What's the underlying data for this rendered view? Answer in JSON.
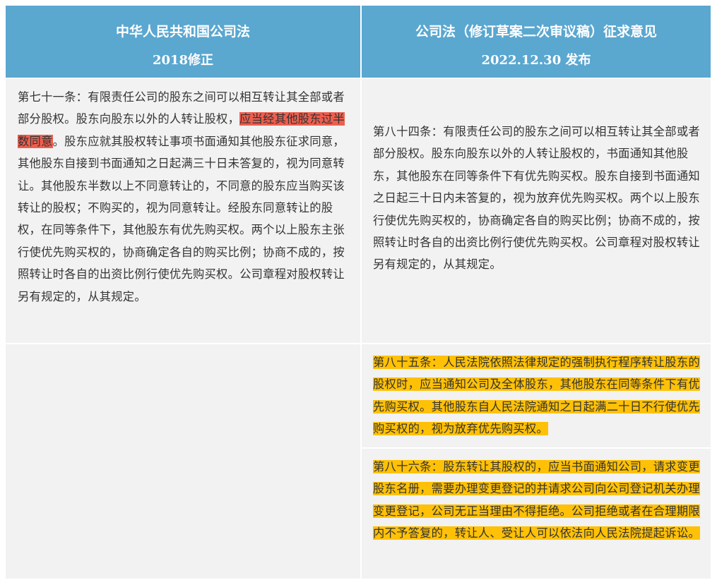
{
  "headers": {
    "left": {
      "title": "中华人民共和国公司法",
      "subtitle": "2018修正"
    },
    "right": {
      "title": "公司法（修订草案二次审议稿）征求意见",
      "subtitle": "2022.12.30 发布"
    }
  },
  "left_article": {
    "part1": "第七十一条：有限责任公司的股东之间可以相互转让其全部或者部分股权。股东向股东以外的人转让股权，",
    "highlight": "应当经其他股东过半数同意",
    "part2": "。股东应就其股权转让事项书面通知其他股东征求同意，其他股东自接到书面通知之日起满三十日未答复的，视为同意转让。其他股东半数以上不同意转让的，不同意的股东应当购买该转让的股权；不购买的，视为同意转让。经股东同意转让的股权，在同等条件下，其他股东有优先购买权。两个以上股东主张行使优先购买权的，协商确定各自的购买比例；协商不成的，按照转让时各自的出资比例行使优先购买权。公司章程对股权转让另有规定的，从其规定。"
  },
  "right_articles": {
    "art84": "第八十四条：有限责任公司的股东之间可以相互转让其全部或者部分股权。股东向股东以外的人转让股权的，书面通知其他股东，其他股东在同等条件下有优先购买权。股东自接到书面通知之日起三十日内未答复的，视为放弃优先购买权。两个以上股东行使优先购买权的，协商确定各自的购买比例；协商不成的，按照转让时各自的出资比例行使优先购买权。公司章程对股权转让另有规定的，从其规定。",
    "art85": "第八十五条：人民法院依照法律规定的强制执行程序转让股东的股权时，应当通知公司及全体股东，其他股东在同等条件下有优先购买权。其他股东自人民法院通知之日起满二十日不行使优先购买权的，视为放弃优先购买权。",
    "art86": "第八十六条：股东转让其股权的，应当书面通知公司，请求变更股东名册，需要办理变更登记的并请求公司向公司登记机关办理变更登记，公司无正当理由不得拒绝。公司拒绝或者在合理期限内不予答复的，转让人、受让人可以依法向人民法院提起诉讼。"
  },
  "colors": {
    "header_bg": "#5aa7d0",
    "cell_bg": "#f2f2f2",
    "red_highlight": "#ee5e4e",
    "yellow_highlight": "#ffc107"
  }
}
